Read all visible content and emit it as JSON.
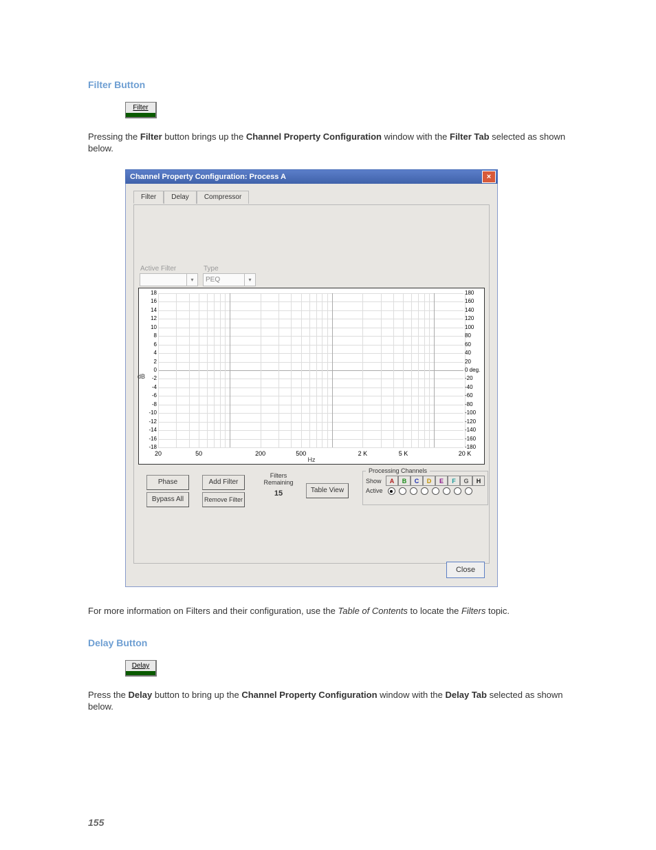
{
  "heading1": "Filter Button",
  "mini_filter": {
    "label": "Filter",
    "bar": "#0a5a00"
  },
  "para1": {
    "pre": "Pressing the ",
    "b1": "Filter",
    "mid1": " button brings up the ",
    "b2": "Channel Property Configuration",
    "mid2": " window with the ",
    "b3": "Filter Tab",
    "after": " selected as shown below."
  },
  "window_title": "Channel Property Configuration: Process A",
  "tabs": [
    "Filter",
    "Delay",
    "Compressor"
  ],
  "active_tab": "Filter",
  "dd1_label": "Active Filter",
  "dd2_label": "Type",
  "dd2_value": "PEQ",
  "chart_data": {
    "type": "line",
    "title": "",
    "xlabel": "Hz",
    "ylabel": "dB",
    "y2label": "deg.",
    "xscale": "log",
    "xticks": [
      20,
      50,
      200,
      500,
      2000,
      5000,
      20000
    ],
    "xtick_labels": [
      "20",
      "50",
      "200",
      "500",
      "2 K",
      "5 K",
      "20 K"
    ],
    "ylim": [
      -18,
      18
    ],
    "yticks": [
      18,
      16,
      14,
      12,
      10,
      8,
      6,
      4,
      2,
      0,
      -2,
      -4,
      -6,
      -8,
      -10,
      -12,
      -14,
      -16,
      -18
    ],
    "y2lim": [
      -180,
      180
    ],
    "y2ticks": [
      180,
      160,
      140,
      120,
      100,
      80,
      60,
      40,
      20,
      0,
      -20,
      -40,
      -60,
      -80,
      -100,
      -120,
      -140,
      -160,
      -180
    ],
    "y2_zero_label": "0 deg.",
    "series": []
  },
  "btn_phase": "Phase",
  "btn_bypass": "Bypass All",
  "btn_add": "Add Filter",
  "btn_remove": "Remove Filter",
  "filters_remaining_label": "Filters Remaining",
  "filters_remaining_value": "15",
  "btn_tableview": "Table View",
  "proc_group_label": "Processing Channels",
  "show_label": "Show",
  "active_label": "Active",
  "channels": [
    {
      "letter": "A",
      "color": "#b02020",
      "active": true
    },
    {
      "letter": "B",
      "color": "#1a8a1a",
      "active": false
    },
    {
      "letter": "C",
      "color": "#2030b0",
      "active": false
    },
    {
      "letter": "D",
      "color": "#c09000",
      "active": false
    },
    {
      "letter": "E",
      "color": "#8a1a8a",
      "active": false
    },
    {
      "letter": "F",
      "color": "#1a9a9a",
      "active": false
    },
    {
      "letter": "G",
      "color": "#555555",
      "active": false
    },
    {
      "letter": "H",
      "color": "#1a1a1a",
      "active": false
    }
  ],
  "close_label": "Close",
  "para2": {
    "pre": "For more information on Filters and their configuration, use the ",
    "i1": "Table of Contents",
    "mid": " to locate the ",
    "i2": "Filters",
    "after": " topic."
  },
  "heading2": "Delay Button",
  "mini_delay": {
    "label": "Delay",
    "bar": "#0a5a00"
  },
  "para3": {
    "pre": "Press the ",
    "b1": "Delay",
    "mid1": " button to bring up the ",
    "b2": "Channel Property Configuration",
    "mid2": " window with the ",
    "b3": "Delay Tab",
    "after": " selected as shown below."
  },
  "page_number": "155"
}
